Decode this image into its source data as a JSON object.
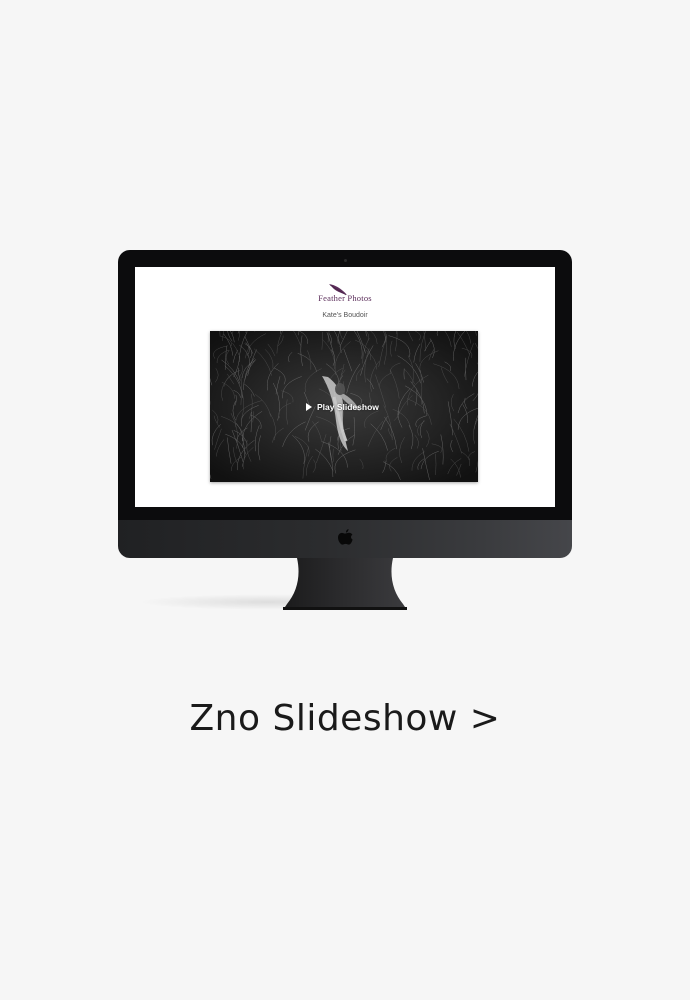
{
  "screen": {
    "brand_name": "Feather Photos",
    "gallery_title": "Kate's Boudoir",
    "play_label": "Play Slideshow"
  },
  "caption": {
    "link_text": "Zno Slideshow >"
  },
  "icons": {
    "logo": "feather-icon",
    "play": "play-icon",
    "computer_brand": "apple-logo-icon"
  },
  "colors": {
    "page_background": "#f6f6f6",
    "brand_accent": "#5b2d5a",
    "bezel": "#0c0c0d"
  }
}
